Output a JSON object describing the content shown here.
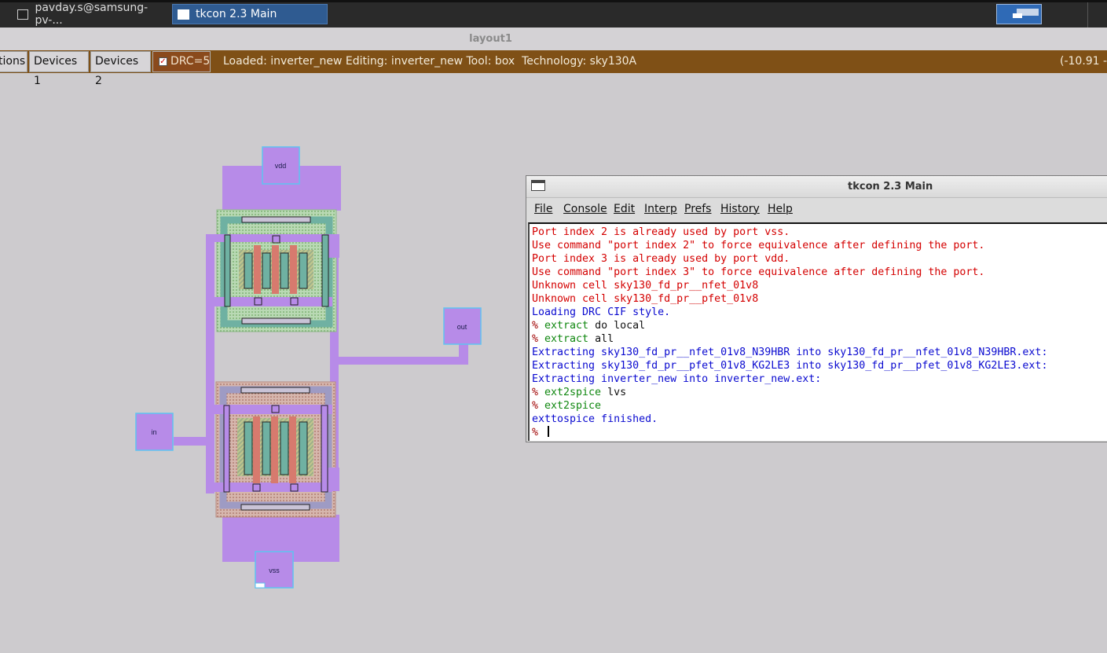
{
  "taskbar": {
    "tasks": [
      {
        "label": "pavday.s@samsung-pv-..."
      },
      {
        "label": "tkcon 2.3 Main"
      }
    ]
  },
  "magic": {
    "window_title": "layout1",
    "buttons": [
      "tions",
      "Devices 1",
      "Devices 2"
    ],
    "drc_label": "DRC=5",
    "status_text": "Loaded: inverter_new Editing: inverter_new Tool: box  Technology: sky130A",
    "coords": "(-10.91 -"
  },
  "layout": {
    "labels": {
      "vdd": "vdd",
      "out": "out",
      "in": "in",
      "vss": "vss"
    },
    "colors": {
      "metal1": "#b78be8",
      "label_box": "#5fc3f0",
      "poly": "#d77a6e",
      "diff": "#6fb1a2"
    }
  },
  "tkcon": {
    "title": "tkcon 2.3 Main",
    "menu": [
      "File",
      "Console",
      "Edit",
      "Interp",
      "Prefs",
      "History",
      "Help"
    ],
    "lines": [
      {
        "prompt": "",
        "text": "Port index 2 is already used by port vss.",
        "style": "red"
      },
      {
        "prompt": "",
        "text": "Use command \"port index 2\" to force equivalence after defining the port.",
        "style": "red"
      },
      {
        "prompt": "",
        "text": "Port index 3 is already used by port vdd.",
        "style": "red"
      },
      {
        "prompt": "",
        "text": "Use command \"port index 3\" to force equivalence after defining the port.",
        "style": "red"
      },
      {
        "prompt": "",
        "text": "Unknown cell sky130_fd_pr__nfet_01v8",
        "style": "red"
      },
      {
        "prompt": "",
        "text": "Unknown cell sky130_fd_pr__pfet_01v8",
        "style": "red"
      },
      {
        "prompt": "",
        "text": "Loading DRC CIF style.",
        "style": "blue"
      },
      {
        "prompt": "% ",
        "cmd": "extract",
        "args": " do local",
        "style": "cmd"
      },
      {
        "prompt": "% ",
        "cmd": "extract",
        "args": " all",
        "style": "cmd"
      },
      {
        "prompt": "",
        "text": "Extracting sky130_fd_pr__nfet_01v8_N39HBR into sky130_fd_pr__nfet_01v8_N39HBR.ext:",
        "style": "blue"
      },
      {
        "prompt": "",
        "text": "Extracting sky130_fd_pr__pfet_01v8_KG2LE3 into sky130_fd_pr__pfet_01v8_KG2LE3.ext:",
        "style": "blue"
      },
      {
        "prompt": "",
        "text": "Extracting inverter_new into inverter_new.ext:",
        "style": "blue"
      },
      {
        "prompt": "% ",
        "cmd": "ext2spice",
        "args": " lvs",
        "style": "cmd"
      },
      {
        "prompt": "% ",
        "cmd": "ext2spice",
        "args": "",
        "style": "cmd"
      },
      {
        "prompt": "",
        "text": "exttospice finished.",
        "style": "blue"
      },
      {
        "prompt": "% ",
        "cmd": "",
        "args": "",
        "style": "input"
      }
    ]
  }
}
